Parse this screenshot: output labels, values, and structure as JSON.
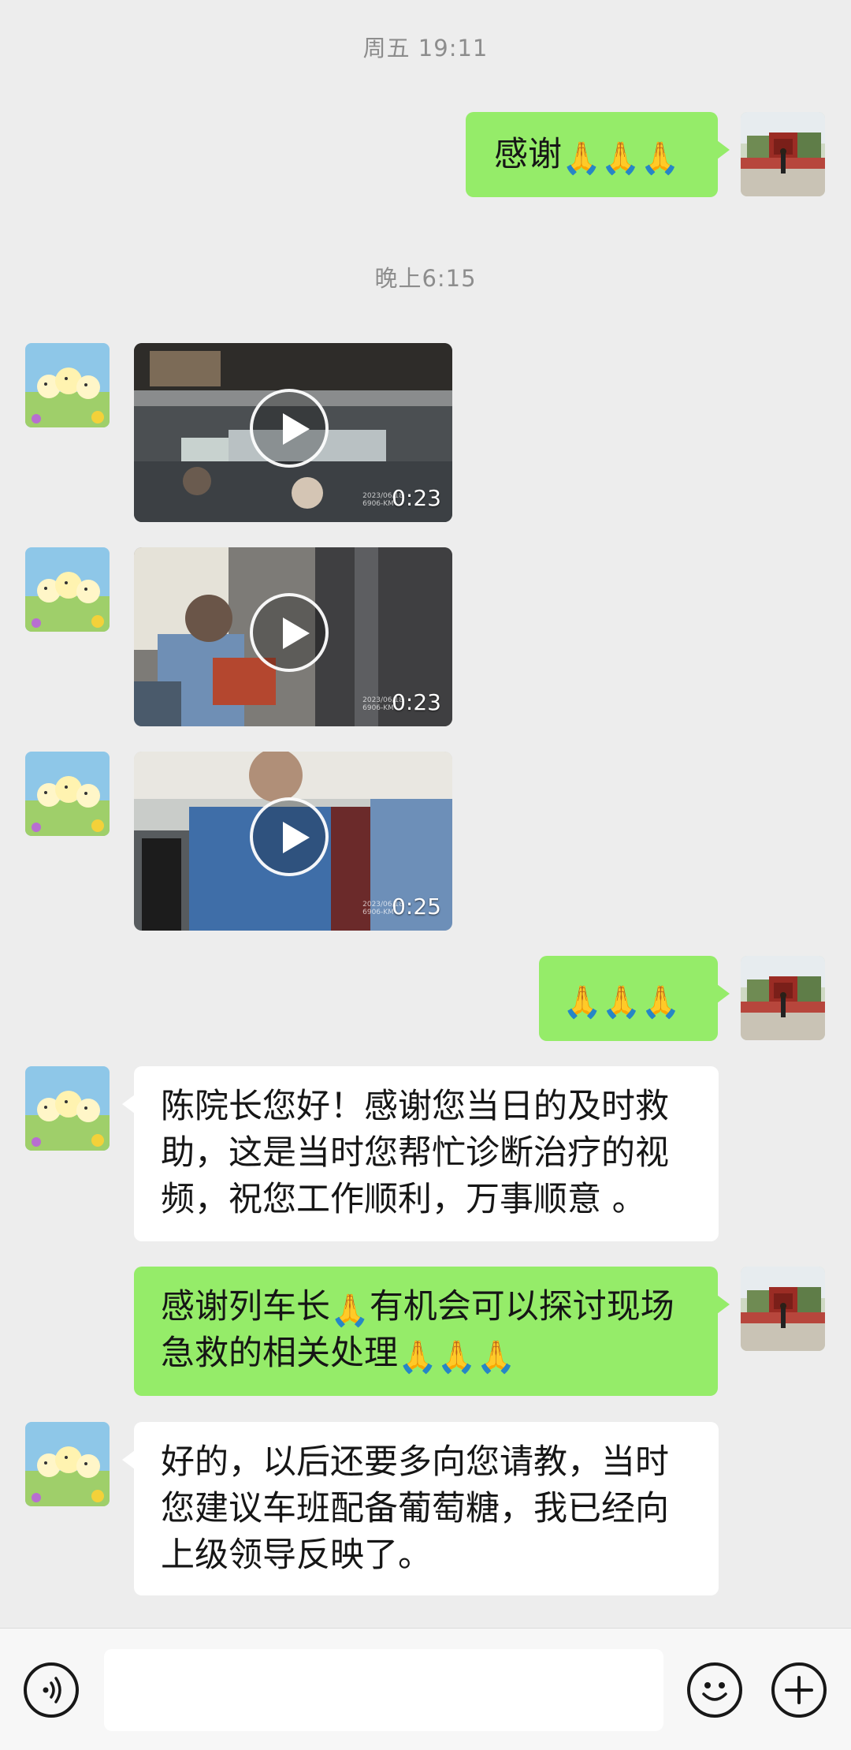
{
  "timestamps": {
    "first": "周五 19:11",
    "second": "晚上6:15"
  },
  "messages": {
    "m1": {
      "sender": "me",
      "text": "感谢",
      "emoji": "🙏🙏🙏"
    },
    "videos": [
      {
        "duration": "0:23"
      },
      {
        "duration": "0:23"
      },
      {
        "duration": "0:25"
      }
    ],
    "m2": {
      "sender": "me",
      "emoji": "🙏🙏🙏"
    },
    "m3": {
      "sender": "other",
      "lines": [
        "陈院长您好！感谢您当日的及时救",
        "助，这是当时您帮忙诊断治疗的视",
        "频，祝您工作顺利，万事顺意 。"
      ]
    },
    "m4": {
      "sender": "me",
      "line1_a": "感谢列车长",
      "line1_emoji": "🙏",
      "line1_b": "有机会可以探讨现场",
      "line2_a": "急救的相关处理",
      "line2_emoji": "🙏🙏🙏"
    },
    "m5": {
      "sender": "other",
      "lines": [
        "好的，以后还要多向您请教，当时",
        "您建议车班配备葡萄糖，我已经向",
        "上级领导反映了。"
      ]
    }
  },
  "input_bar": {
    "voice_icon": "voice-icon",
    "emoji_icon": "emoji-icon",
    "plus_icon": "plus-icon",
    "input_value": ""
  },
  "colors": {
    "background": "#ededed",
    "my_bubble": "#95ec69",
    "their_bubble": "#ffffff",
    "timestamp_text": "#8d8d8d"
  }
}
